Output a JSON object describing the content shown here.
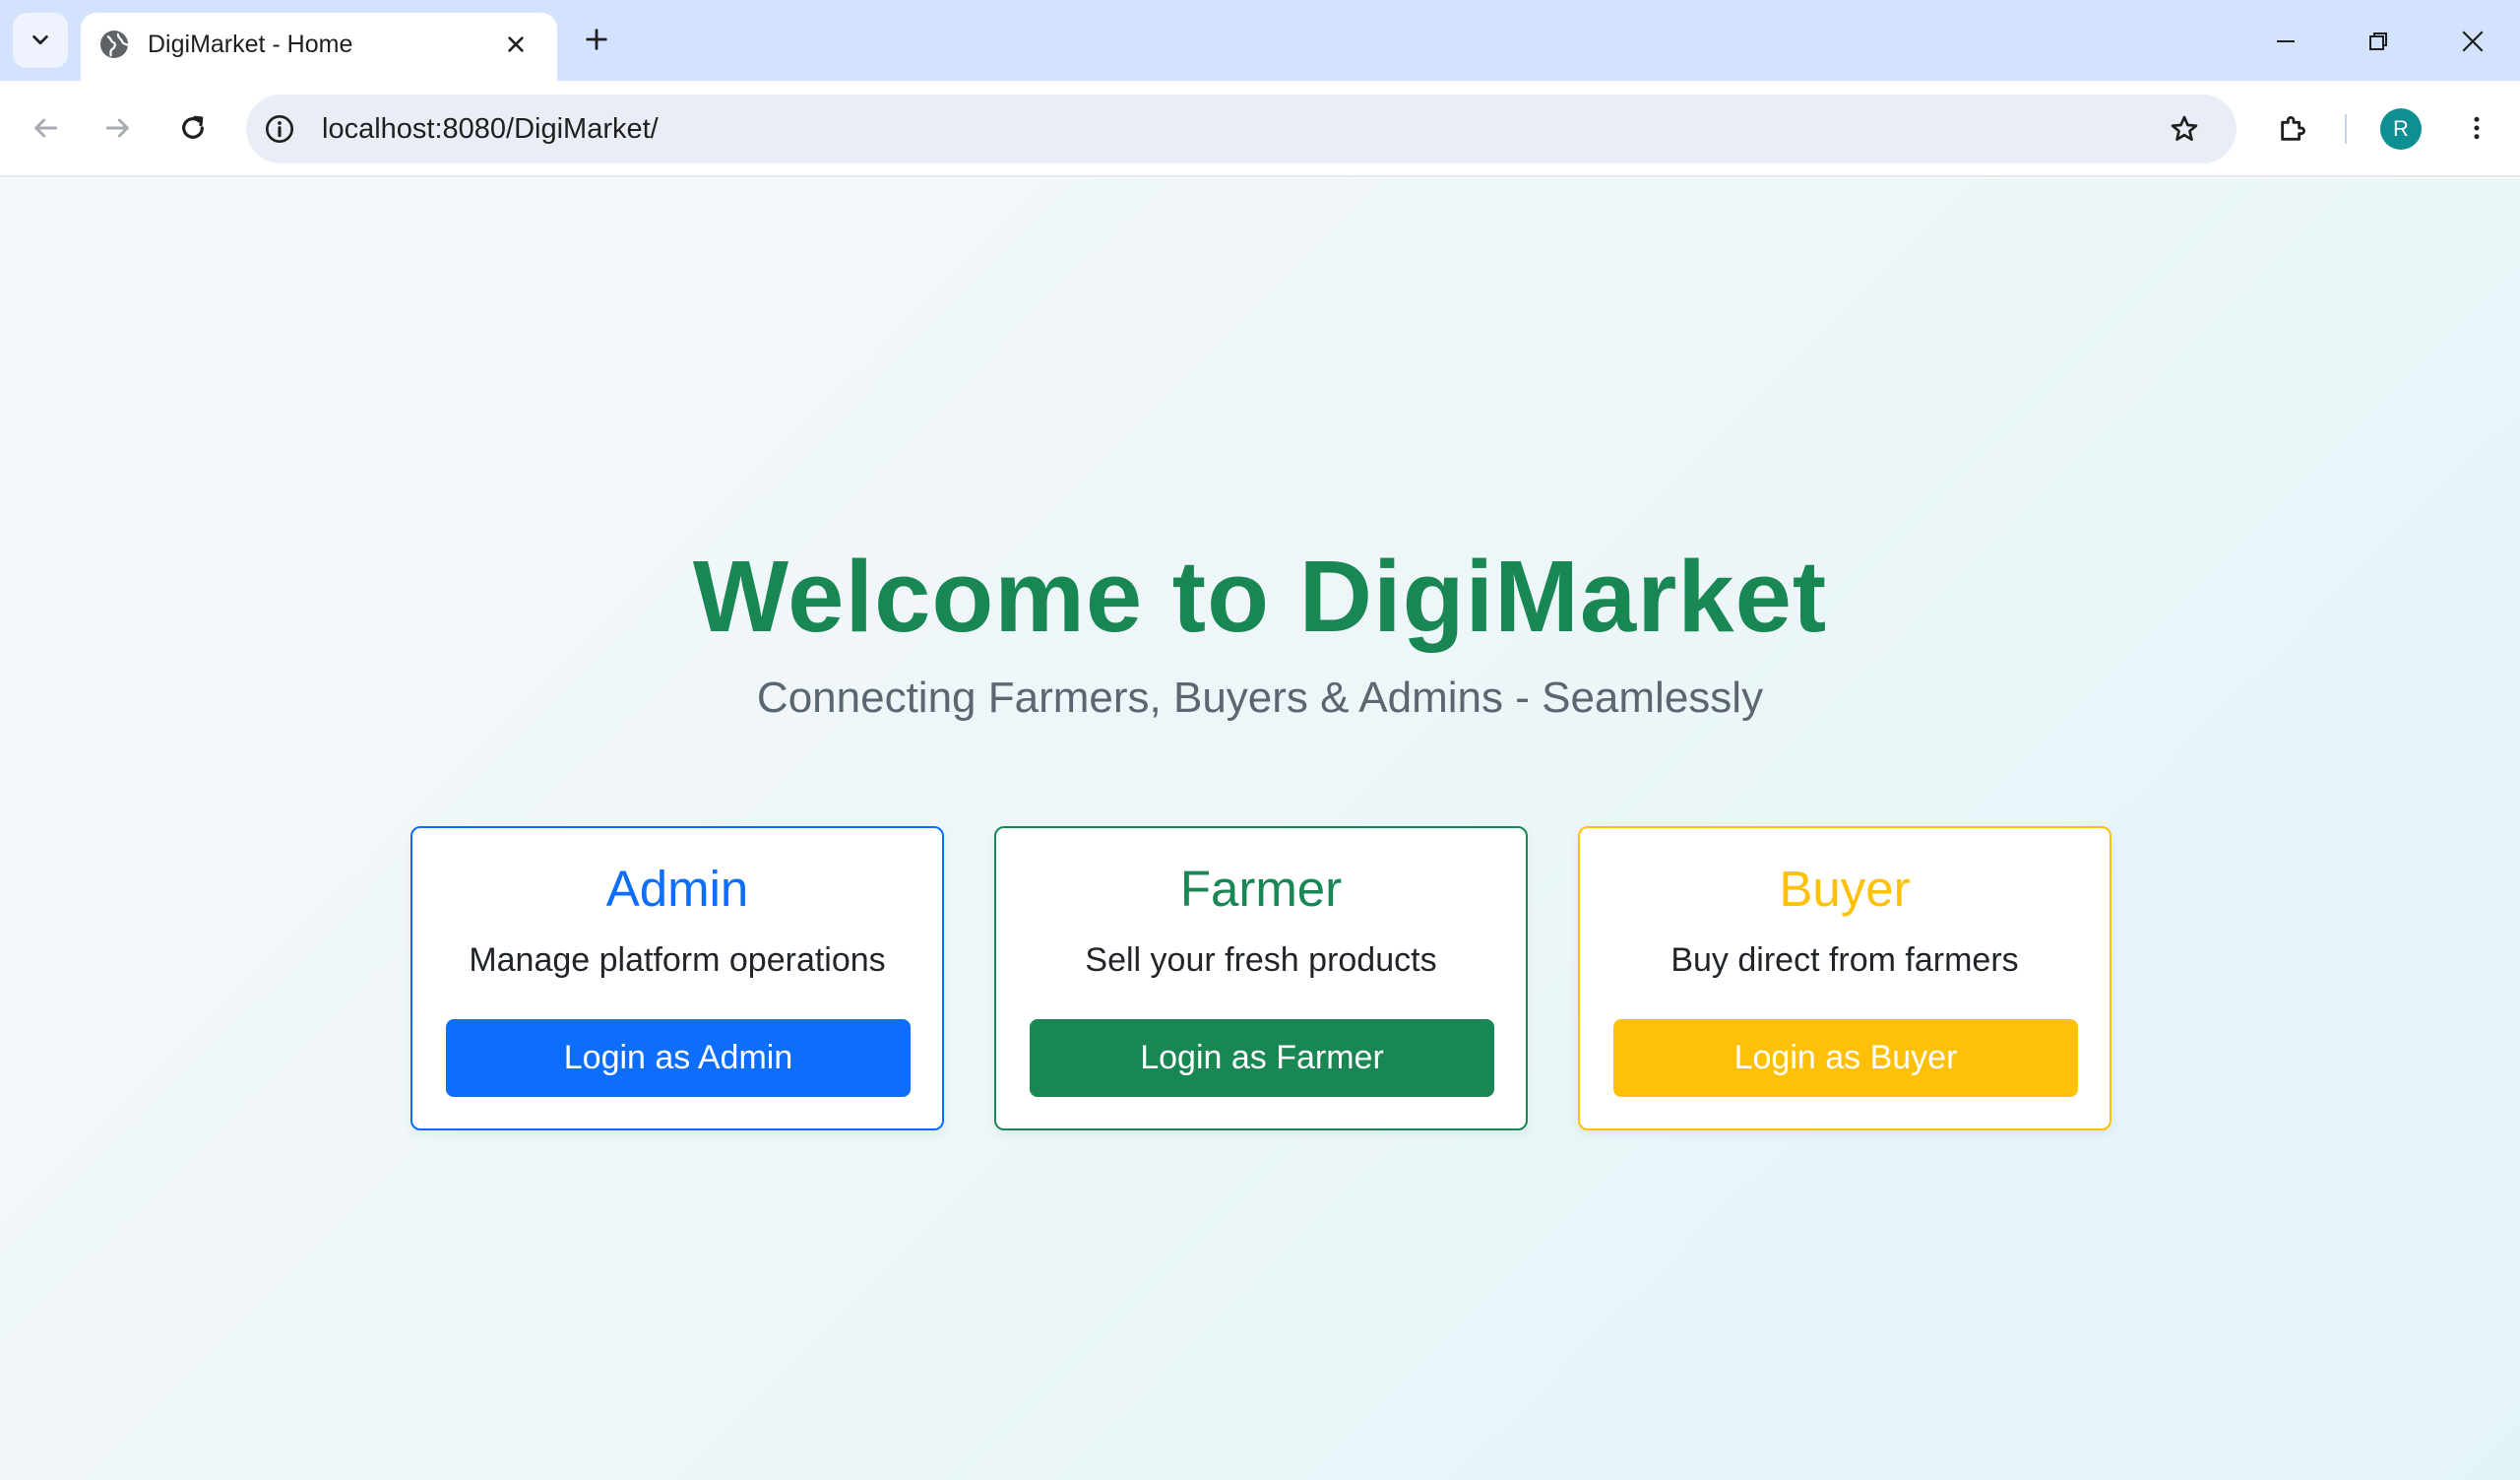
{
  "browser": {
    "tab_title": "DigiMarket - Home",
    "url": "localhost:8080/DigiMarket/",
    "profile_initial": "R"
  },
  "hero": {
    "title": "Welcome to DigiMarket",
    "subtitle": "Connecting Farmers, Buyers & Admins - Seamlessly"
  },
  "cards": [
    {
      "title": "Admin",
      "description": "Manage platform operations",
      "button_label": "Login as Admin",
      "color": "#0d6efd"
    },
    {
      "title": "Farmer",
      "description": "Sell your fresh products",
      "button_label": "Login as Farmer",
      "color": "#198754"
    },
    {
      "title": "Buyer",
      "description": "Buy direct from farmers",
      "button_label": "Login as Buyer",
      "color": "#ffc107"
    }
  ],
  "icons": {
    "tab_search": "chevron-down-icon",
    "favicon": "globe-icon",
    "tab_close": "close-icon",
    "new_tab": "plus-icon",
    "minimize": "minimize-icon",
    "restore": "restore-icon",
    "close_window": "close-icon",
    "back": "arrow-left-icon",
    "forward": "arrow-right-icon",
    "reload": "reload-icon",
    "site_info": "info-icon",
    "bookmark": "star-icon",
    "extensions": "puzzle-icon",
    "menu": "kebab-icon"
  }
}
